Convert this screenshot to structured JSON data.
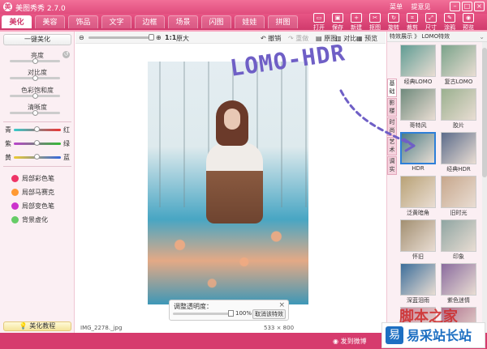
{
  "titlebar": {
    "app_title": "美图秀秀 2.7.0",
    "links": [
      "菜单",
      "提意见"
    ],
    "window_buttons": [
      "–",
      "□",
      "×"
    ]
  },
  "tabs": [
    "美化",
    "美容",
    "饰品",
    "文字",
    "边框",
    "场景",
    "闪图",
    "娃娃",
    "拼图"
  ],
  "active_tab": 0,
  "tools": [
    "打开",
    "保存",
    "新建",
    "抠图",
    "旋转",
    "裁剪",
    "尺寸",
    "涂鸦",
    "预览"
  ],
  "left": {
    "one_key": "一键美化",
    "sliders": [
      "亮度",
      "对比度",
      "色彩饱和度",
      "清晰度"
    ],
    "color_rows": [
      {
        "left": "青",
        "right": "红"
      },
      {
        "left": "紫",
        "right": "绿"
      },
      {
        "left": "黄",
        "right": "蓝"
      }
    ],
    "tools": [
      "局部彩色笔",
      "局部马赛克",
      "局部变色笔",
      "背景虚化"
    ],
    "tutorial": "美化教程"
  },
  "center": {
    "zoom_label": "1:1",
    "zoom_original": "原大",
    "undo": "撤销",
    "redo": "重做",
    "original": "原图",
    "compare": "对比",
    "preview": "预览",
    "opacity_title": "调整透明度：",
    "opacity_value": "100%",
    "cancel_effect": "取消该特效",
    "close": "×",
    "filename": "IMG_2278._jpg",
    "dimensions": "533 × 800"
  },
  "right": {
    "breadcrumb": "特效展示 》 LOMO特效",
    "vtabs": [
      "基础",
      "影楼",
      "时尚",
      "艺术",
      "调实"
    ],
    "thumbs": [
      {
        "label": "经典LOMO",
        "color": "#5f9c93"
      },
      {
        "label": "复古LOMO",
        "color": "#7aa38a"
      },
      {
        "label": "哥特风",
        "color": "#6f8a7c"
      },
      {
        "label": "胶片",
        "color": "#9ab08f"
      },
      {
        "label": "HDR",
        "color": "#4e7e86"
      },
      {
        "label": "经典HDR",
        "color": "#5b6b8a"
      },
      {
        "label": "泛黄暗角",
        "color": "#b9a276"
      },
      {
        "label": "旧时光",
        "color": "#c7a78c"
      },
      {
        "label": "怀旧",
        "color": "#a28f71"
      },
      {
        "label": "印象",
        "color": "#8fa5a2"
      },
      {
        "label": "深蓝泪雨",
        "color": "#3c6e9a"
      },
      {
        "label": "紫色迷情",
        "color": "#8a6b9e"
      },
      {
        "label": "",
        "color": "#c98a9e"
      },
      {
        "label": "",
        "color": "#b0728e"
      }
    ],
    "selected": 4
  },
  "statusbar": {
    "weibo": "发到微博"
  },
  "annotation": "LOMO-HDR",
  "watermark": {
    "text1": "脚本之家",
    "text2": "易采站长站",
    "badge": "易"
  }
}
